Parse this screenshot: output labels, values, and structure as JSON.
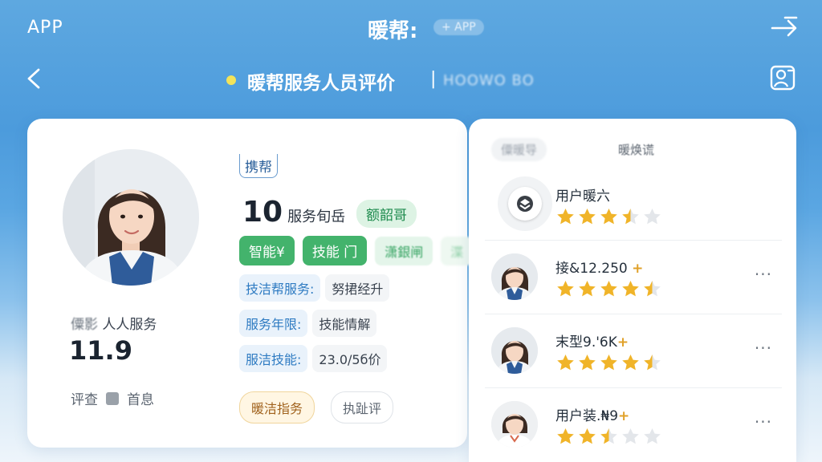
{
  "topbar": {
    "app_label": "APP",
    "title": "暖帮:",
    "pill": "+ APP"
  },
  "navbar": {
    "title": "暖帮服务人员评价",
    "separator": "|",
    "subtitle": "HOOWO BO"
  },
  "profile": {
    "stat_label_blur": "僳影",
    "stat_label": "人人服务",
    "stat_value": "11.9",
    "rate_left": "评查",
    "rate_right": "首息",
    "brand_tag": "携帮",
    "service_count": "10",
    "service_unit": "服务旬岳",
    "count_badge": "额韶哥",
    "tags": [
      "智能¥",
      "技能 门",
      "潇銀闸",
      "渫"
    ],
    "info": [
      {
        "key": "技洁帮服务:",
        "value": "努捃经升"
      },
      {
        "key": "服务年限:",
        "value": "技能情解"
      },
      {
        "key": "服洁技能:",
        "value": "23.0/5б价"
      }
    ],
    "chip_warm": "暖洁指务",
    "chip_plain": "执趾评"
  },
  "reviews_panel": {
    "tab_blur": "僳暖导",
    "tab_active": "暖焕谎",
    "reviews": [
      {
        "name": "用户暖六",
        "plus": "",
        "rating": 3.5,
        "avatar": "logo",
        "more": ""
      },
      {
        "name": "接&12.250",
        "plus": "+",
        "rating": 4.5,
        "avatar": "photo",
        "more": "···"
      },
      {
        "name": "末型9.'6K",
        "plus": "+",
        "rating": 4.5,
        "avatar": "photo",
        "more": "···"
      },
      {
        "name": "用户装.₦9",
        "plus": "+",
        "rating": 2.5,
        "avatar": "photo-white",
        "more": "···"
      }
    ]
  },
  "colors": {
    "accent_blue": "#2e7bc2",
    "accent_green": "#43b36c",
    "star_gold": "#f0b429",
    "header_blue": "#4c9bdc"
  },
  "icons": [
    "exit-icon",
    "back-icon",
    "profile-icon",
    "star-icon",
    "more-icon",
    "logo-icon"
  ]
}
